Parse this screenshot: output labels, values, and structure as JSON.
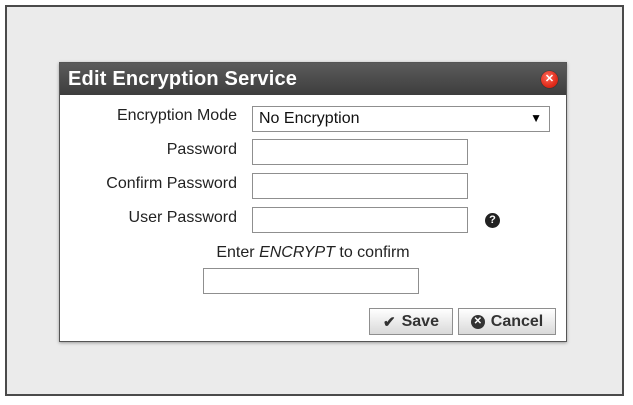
{
  "dialog": {
    "title": "Edit Encryption Service",
    "close_icon": "close-icon"
  },
  "form": {
    "encryption_mode": {
      "label": "Encryption Mode",
      "value": "No Encryption"
    },
    "password": {
      "label": "Password",
      "value": ""
    },
    "confirm_password": {
      "label": "Confirm Password",
      "value": ""
    },
    "user_password": {
      "label": "User Password",
      "value": ""
    },
    "confirm": {
      "prefix": "Enter",
      "keyword": "ENCRYPT",
      "suffix": "to confirm",
      "value": ""
    }
  },
  "buttons": {
    "save_label": "Save",
    "cancel_label": "Cancel"
  },
  "icons": {
    "help": "help-icon",
    "save": "check-icon",
    "cancel": "cancel-icon"
  }
}
